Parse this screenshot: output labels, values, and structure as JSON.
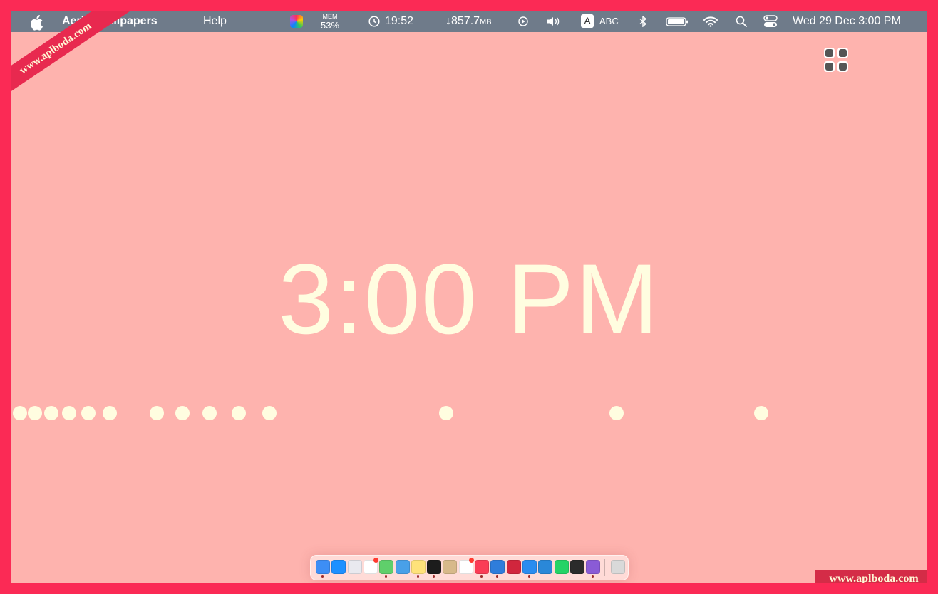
{
  "menubar": {
    "app_name": "Aerial Wallpapers",
    "help": "Help",
    "mem_label": "MEM",
    "mem_value": "53%",
    "clock_time": "19:52",
    "net_value": "↓857.7",
    "net_unit": "MB",
    "input_badge": "A",
    "input_source": "ABC",
    "datetime": "Wed 29 Dec  3:00 PM"
  },
  "screensaver": {
    "time": "3:00 PM"
  },
  "watermarks": {
    "ribbon": "www.aplboda.com",
    "corner": "www.aplboda.com"
  },
  "dock": {
    "apps": [
      {
        "icon": "finder-icon",
        "color": "#3d8ef5"
      },
      {
        "icon": "app-store-icon",
        "color": "#1e90ff"
      },
      {
        "icon": "launchpad-icon",
        "color": "#e9e9ef"
      },
      {
        "icon": "calendar-icon",
        "color": "#ffffff"
      },
      {
        "icon": "pencil-app-icon",
        "color": "#5fcf6b"
      },
      {
        "icon": "preview-icon",
        "color": "#49a0e8"
      },
      {
        "icon": "notes-icon",
        "color": "#ffe27a"
      },
      {
        "icon": "clock-app-icon",
        "color": "#1c1c1c"
      },
      {
        "icon": "notepad-icon",
        "color": "#d7b98a"
      },
      {
        "icon": "reminders-icon",
        "color": "#ffffff"
      },
      {
        "icon": "music-icon",
        "color": "#fa3c55"
      },
      {
        "icon": "xcode-icon",
        "color": "#2f7ddb"
      },
      {
        "icon": "photo-app-icon",
        "color": "#d1263d"
      },
      {
        "icon": "safari-icon",
        "color": "#2a8cf0"
      },
      {
        "icon": "vscode-icon",
        "color": "#2a88d8"
      },
      {
        "icon": "whatsapp-icon",
        "color": "#25d366"
      },
      {
        "icon": "terminal-icon",
        "color": "#2b2b2b"
      },
      {
        "icon": "aerial-icon",
        "color": "#8a5bd6"
      },
      {
        "icon": "trash-icon",
        "color": "#d9d9d9"
      }
    ]
  }
}
